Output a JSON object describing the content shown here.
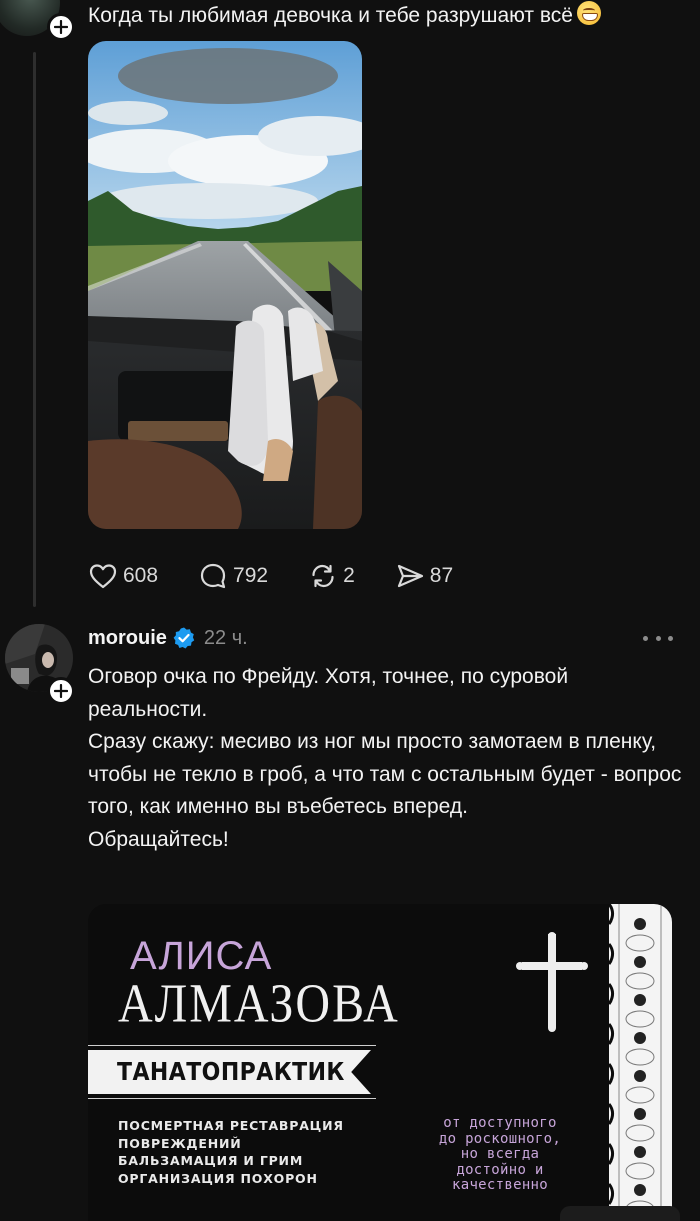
{
  "post1": {
    "text": "Когда ты любимая девочка и тебе разрушают всё",
    "emoji_icon": "grinning-face-emoji",
    "stats": {
      "likes": "608",
      "comments": "792",
      "reposts": "2",
      "shares": "87"
    }
  },
  "post2": {
    "username": "morouie",
    "time": "22 ч.",
    "paragraphs": [
      "Оговор очка по Фрейду. Хотя, точнее, по суровой реальности.",
      "Сразу скажу: месиво из ног мы просто замотаем в пленку, чтобы не текло в гроб, а что там с остальным будет - вопрос того, как именно вы въебетесь вперед.",
      "Обращайтесь!"
    ],
    "card": {
      "first_name": "АЛИСА",
      "last_name": "АЛМАЗОВА",
      "title": "ТАНАТОПРАКТИК",
      "services": [
        "ПОСМЕРТНАЯ РЕСТАВРАЦИЯ",
        "ПОВРЕЖДЕНИЙ",
        "БАЛЬЗАМАЦИЯ И ГРИМ",
        "ОРГАНИЗАЦИЯ ПОХОРОН"
      ],
      "tagline": [
        "от доступного",
        "до роскошного,",
        "но всегда",
        "достойно и",
        "качественно"
      ],
      "accent_color": "#c7a5d9"
    }
  },
  "colors": {
    "background": "#101010",
    "text": "#f3f3f3",
    "muted": "#8c8c8c",
    "verified": "#1d9bf0"
  }
}
